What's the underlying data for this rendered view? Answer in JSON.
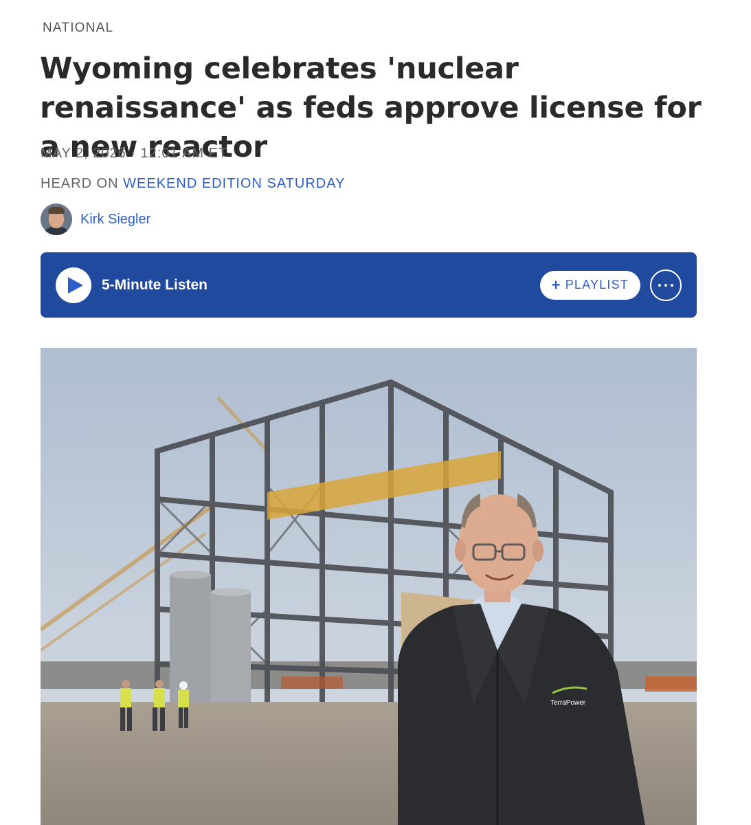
{
  "section": "NATIONAL",
  "headline": "Wyoming celebrates 'nuclear renaissance' as feds approve license for a new reactor",
  "dateline": "MAY 2, 2026 · 12:01 AM ET",
  "heard_on": {
    "prefix": "HEARD ON",
    "program": "WEEKEND EDITION SATURDAY"
  },
  "author": {
    "name": "Kirk Siegler"
  },
  "player": {
    "listen_label": "5-Minute Listen",
    "playlist_label": "PLAYLIST",
    "playlist_icon": "plus-icon",
    "more_icon": "more-icon",
    "play_icon": "play-icon",
    "background_color": "#1f4a9e"
  },
  "photo": {
    "jacket_logo_text": "TerraPower"
  },
  "colors": {
    "link": "#2d5fcb",
    "meta_text": "#666666"
  }
}
